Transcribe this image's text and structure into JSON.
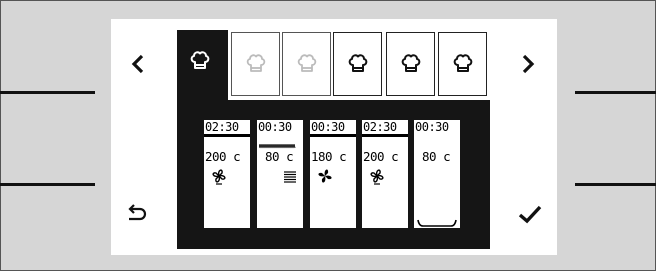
{
  "navigation": {
    "prev_icon": "chevron-left-icon",
    "next_icon": "chevron-right-icon",
    "back_icon": "undo-arrow-icon",
    "confirm_icon": "checkmark-icon"
  },
  "profile_tabs": [
    {
      "icon": "chef-hat-icon",
      "state": "selected"
    },
    {
      "icon": "chef-hat-icon",
      "state": "inactive"
    },
    {
      "icon": "chef-hat-icon",
      "state": "inactive"
    },
    {
      "icon": "chef-hat-icon",
      "state": "active"
    },
    {
      "icon": "chef-hat-icon",
      "state": "active"
    },
    {
      "icon": "chef-hat-icon",
      "state": "active"
    }
  ],
  "stages": [
    {
      "time": "02:30",
      "temp": "200 c",
      "mode_icon": "fan-heat-icon",
      "heating": "bottom-heat-full"
    },
    {
      "time": "00:30",
      "temp": " 80 c",
      "mode_icon": "steam-icon",
      "heating": "none"
    },
    {
      "time": "00:30",
      "temp": "180 c",
      "mode_icon": "fan-icon",
      "heating": "none"
    },
    {
      "time": "02:30",
      "temp": "200 c",
      "mode_icon": "fan-heat-icon",
      "heating": "bottom-heat-partial"
    },
    {
      "time": "00:30",
      "temp": " 80 c",
      "mode_icon": "none",
      "heating": "keep-warm-tray"
    }
  ],
  "colors": {
    "background": "#d6d6d6",
    "screen": "#ffffff",
    "dark": "#151515"
  }
}
